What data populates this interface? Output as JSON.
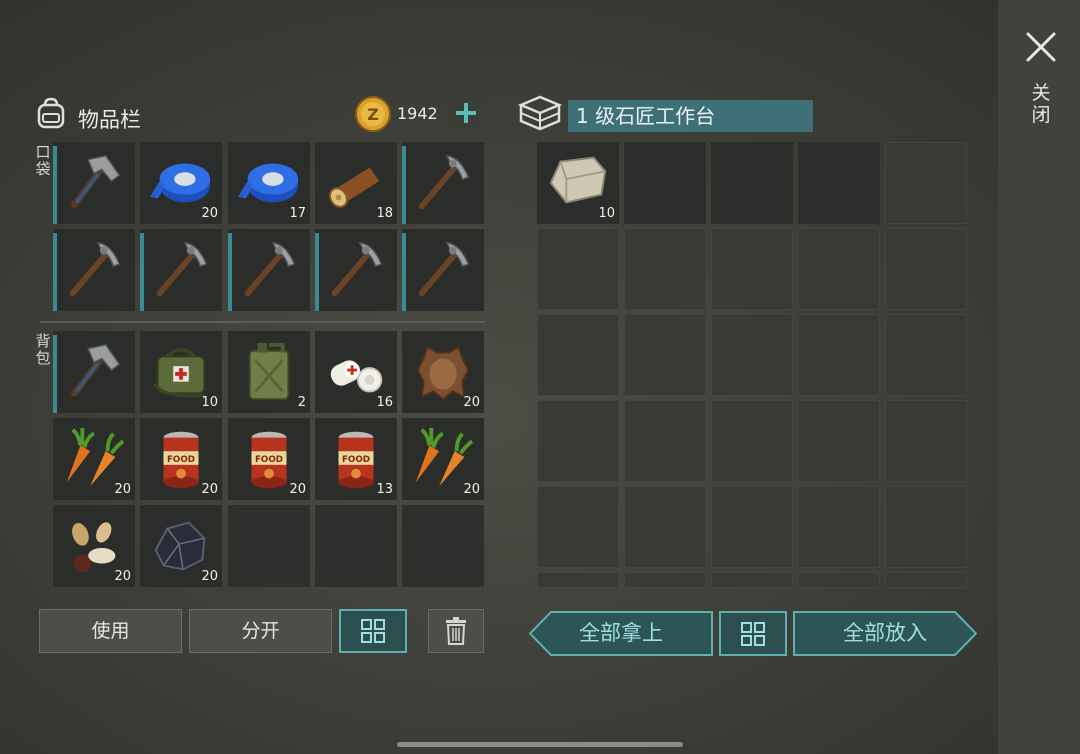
{
  "close": {
    "label": "关闭"
  },
  "inventory": {
    "title": "物品栏",
    "coins": "1942",
    "pocket_label": "口袋",
    "backpack_label": "背包",
    "pocket": [
      {
        "icon": "hammer-icon",
        "count": ""
      },
      {
        "icon": "duct-tape-icon",
        "count": "20"
      },
      {
        "icon": "duct-tape-icon",
        "count": "17"
      },
      {
        "icon": "log-icon",
        "count": "18"
      },
      {
        "icon": "pickaxe-icon",
        "count": ""
      },
      {
        "icon": "pickaxe-icon",
        "count": ""
      },
      {
        "icon": "pickaxe-icon",
        "count": ""
      },
      {
        "icon": "pickaxe-icon",
        "count": ""
      },
      {
        "icon": "pickaxe-icon",
        "count": ""
      },
      {
        "icon": "pickaxe-icon",
        "count": ""
      }
    ],
    "backpack": [
      {
        "icon": "hammer-icon",
        "count": ""
      },
      {
        "icon": "first-aid-kit-icon",
        "count": "10"
      },
      {
        "icon": "jerrycan-icon",
        "count": "2"
      },
      {
        "icon": "bandage-icon",
        "count": "16"
      },
      {
        "icon": "animal-hide-icon",
        "count": "20"
      },
      {
        "icon": "carrot-icon",
        "count": "20"
      },
      {
        "icon": "canned-food-icon",
        "count": "20"
      },
      {
        "icon": "canned-food-icon",
        "count": "20"
      },
      {
        "icon": "canned-food-icon",
        "count": "13"
      },
      {
        "icon": "carrot-icon",
        "count": "20"
      },
      {
        "icon": "seeds-icon",
        "count": "20"
      },
      {
        "icon": "coal-icon",
        "count": "20"
      },
      {
        "icon": "",
        "count": ""
      },
      {
        "icon": "",
        "count": ""
      },
      {
        "icon": "",
        "count": ""
      }
    ],
    "buttons": {
      "use": "使用",
      "split": "分开"
    }
  },
  "workbench": {
    "title": "1 级石匠工作台",
    "item": {
      "icon": "stone-icon",
      "count": "10"
    },
    "buttons": {
      "take_all": "全部拿上",
      "put_all": "全部放入"
    }
  },
  "colors": {
    "accent": "#3e7077",
    "teal_text": "#9ee0e0",
    "durability": "#3d8b92"
  }
}
